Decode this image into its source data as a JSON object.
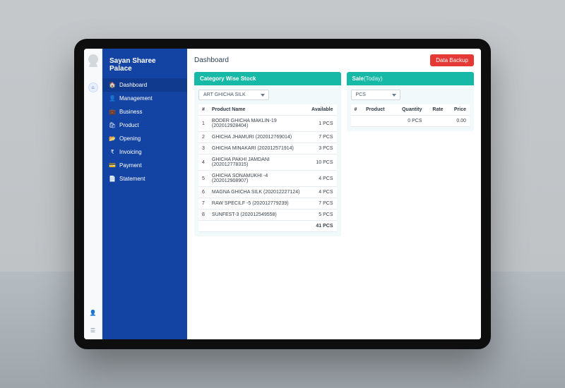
{
  "brand": "Sayan Sharee Palace",
  "page_title": "Dashboard",
  "backup_label": "Data Backup",
  "sidebar": {
    "items": [
      {
        "icon": "🏠",
        "label": "Dashboard"
      },
      {
        "icon": "👤",
        "label": "Management"
      },
      {
        "icon": "💼",
        "label": "Business"
      },
      {
        "icon": "🛍",
        "label": "Product"
      },
      {
        "icon": "📂",
        "label": "Opening"
      },
      {
        "icon": "₹",
        "label": "Invoicing"
      },
      {
        "icon": "💳",
        "label": "Payment"
      },
      {
        "icon": "📄",
        "label": "Statement"
      }
    ]
  },
  "stock_card": {
    "title": "Category Wise Stock",
    "selected": "ART GHICHA SILK",
    "headers": {
      "idx": "#",
      "name": "Product Name",
      "avail": "Available"
    },
    "rows": [
      {
        "idx": "1",
        "name": "BODER GHICHA MAKLIN-19 (202012928404)",
        "avail": "1 PCS"
      },
      {
        "idx": "2",
        "name": "GHICHA JHAMURI (202012769014)",
        "avail": "7 PCS"
      },
      {
        "idx": "3",
        "name": "GHICHA MINAKARI (202012571914)",
        "avail": "3 PCS"
      },
      {
        "idx": "4",
        "name": "GHICHA PAKHI JAMDANI (202012778315)",
        "avail": "10 PCS"
      },
      {
        "idx": "5",
        "name": "GHICHA SONAMUKHI -4 (202012908907)",
        "avail": "4 PCS"
      },
      {
        "idx": "6",
        "name": "MAGNA GHICHA SILK (202012227124)",
        "avail": "4 PCS"
      },
      {
        "idx": "7",
        "name": "RAW SPECILF -5 (202012779239)",
        "avail": "7 PCS"
      },
      {
        "idx": "8",
        "name": "SUNFEST-3 (202012549558)",
        "avail": "5 PCS"
      }
    ],
    "total": "41 PCS"
  },
  "sale_card": {
    "title": "Sale",
    "subtitle": "(Today)",
    "selected": "PCS",
    "headers": {
      "idx": "#",
      "product": "Product",
      "qty": "Quantity",
      "rate": "Rate",
      "price": "Price"
    },
    "summary_qty": "0 PCS",
    "summary_price": "0.00"
  }
}
